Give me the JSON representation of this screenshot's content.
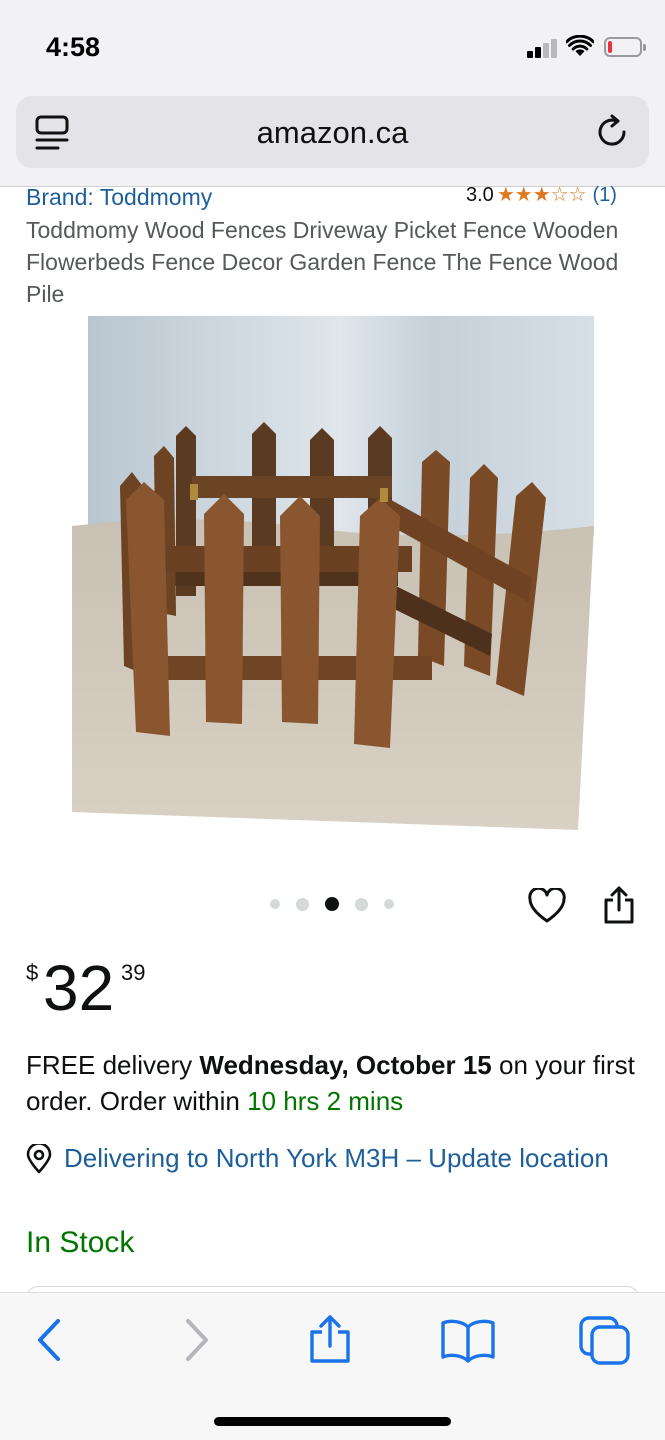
{
  "status_bar": {
    "time": "4:58"
  },
  "browser": {
    "url": "amazon.ca"
  },
  "product": {
    "brand": "Brand: Toddmomy",
    "rating": "3.0",
    "rating_stars": 3,
    "rating_count": "(1)",
    "title": "Toddmomy Wood Fences Driveway Picket Fence Wooden Flowerbeds Fence Decor Garden Fence The Fence Wood Pile",
    "image_carousel": {
      "total": 5,
      "active_index": 2
    }
  },
  "price": {
    "symbol": "$",
    "whole": "32",
    "fraction": "39"
  },
  "delivery": {
    "prefix": "FREE delivery ",
    "date": "Wednesday, October 15",
    "middle": " on your first order. Order within ",
    "countdown": "10 hrs 2 mins"
  },
  "location": {
    "text": "Delivering to North York M3H – Update location"
  },
  "stock_status": "In Stock",
  "colors": {
    "link": "#1f5f99",
    "star": "#de7921",
    "in_stock": "#007600",
    "ios_blue": "#1a73e8"
  },
  "toolbar_icons": [
    "back-icon",
    "forward-icon",
    "share-icon",
    "bookmarks-icon",
    "tabs-icon"
  ]
}
